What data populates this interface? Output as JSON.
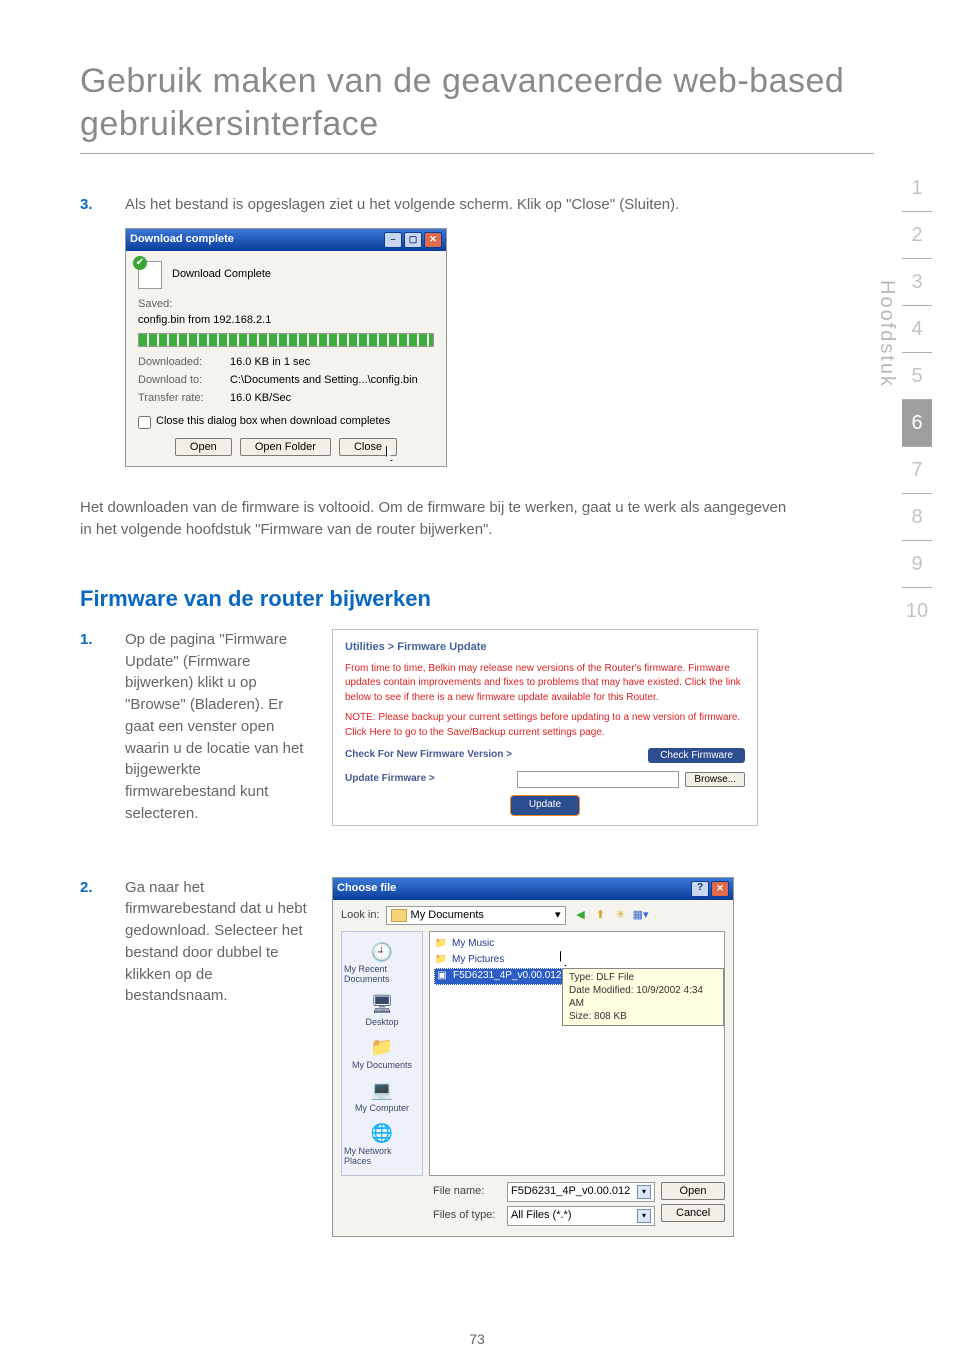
{
  "heading": "Gebruik maken van de geavanceerde web-based gebruikersinterface",
  "step3": {
    "num": "3.",
    "text": "Als het bestand is opgeslagen ziet u het volgende scherm. Klik op \"Close\" (Sluiten)."
  },
  "dlDialog": {
    "title": "Download complete",
    "completeText": "Download Complete",
    "savedLabel": "Saved:",
    "savedValue": "config.bin from 192.168.2.1",
    "downloadedK": "Downloaded:",
    "downloadedV": "16.0 KB in 1 sec",
    "downloadToK": "Download to:",
    "downloadToV": "C:\\Documents and Setting...\\config.bin",
    "transferK": "Transfer rate:",
    "transferV": "16.0 KB/Sec",
    "checkbox": "Close this dialog box when download completes",
    "btnOpen": "Open",
    "btnOpenFolder": "Open Folder",
    "btnClose": "Close"
  },
  "para1": "Het downloaden van de firmware is voltooid. Om de firmware bij te werken, gaat u te werk als aangegeven in het volgende hoofdstuk \"Firmware van de router bijwerken\".",
  "subheading": "Firmware van de router bijwerken",
  "step1": {
    "num": "1.",
    "text": "Op de pagina \"Firmware Update\" (Firmware bijwerken) klikt u op \"Browse\" (Bladeren). Er gaat een venster open waarin u de locatie van het bijgewerkte firmwarebestand kunt selecteren."
  },
  "webpanel": {
    "title": "Utilities > Firmware Update",
    "p1": "From time to time, Belkin may release new versions of the Router's firmware. Firmware updates contain improvements and fixes to problems that may have existed. Click the link below to see if there is a new firmware update available for this Router.",
    "p2a": "NOTE: Please backup your current settings before updating to a new version of firmware. ",
    "p2link": "Click Here",
    "p2b": " to go to the Save/Backup current settings page.",
    "checkLabel": "Check For New Firmware Version >",
    "checkBtn": "Check Firmware",
    "updateLabel": "Update Firmware >",
    "browseBtn": "Browse...",
    "updateBtn": "Update"
  },
  "step2": {
    "num": "2.",
    "text": "Ga naar het firmwarebestand dat u hebt gedownload. Selecteer het bestand door dubbel te klikken op de bestandsnaam."
  },
  "cfDialog": {
    "title": "Choose file",
    "lookInLabel": "Look in:",
    "lookInValue": "My Documents",
    "items": {
      "music": "My Music",
      "pictures": "My Pictures",
      "fw": "F5D6231_4P_v0.00.012.dlf"
    },
    "tooltip": {
      "type": "Type: DLF File",
      "modified": "Date Modified: 10/9/2002 4:34 AM",
      "size": "Size: 808 KB"
    },
    "places": {
      "recent": "My Recent Documents",
      "desktop": "Desktop",
      "docs": "My Documents",
      "computer": "My Computer",
      "network": "My Network Places"
    },
    "fileNameLabel": "File name:",
    "fileNameValue": "F5D6231_4P_v0.00.012",
    "fileTypeLabel": "Files of type:",
    "fileTypeValue": "All Files (*.*)",
    "btnOpen": "Open",
    "btnCancel": "Cancel"
  },
  "sideTabs": [
    "1",
    "2",
    "3",
    "4",
    "5",
    "6",
    "7",
    "8",
    "9",
    "10"
  ],
  "sideActiveIndex": 5,
  "sideLabel": "Hoofdstuk",
  "pageNumber": "73"
}
